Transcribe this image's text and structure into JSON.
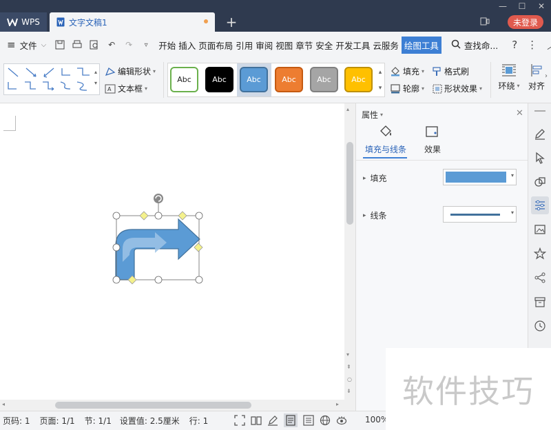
{
  "app": {
    "name": "WPS",
    "doc_tab": "文字文稿1",
    "login": "未登录"
  },
  "menu": {
    "file": "文件",
    "tabs": [
      "开始",
      "插入",
      "页面布局",
      "引用",
      "审阅",
      "视图",
      "章节",
      "安全",
      "开发工具",
      "云服务",
      "绘图工具"
    ],
    "active_tab": "绘图工具",
    "search": "查找命..."
  },
  "ribbon": {
    "edit_shape": "编辑形状",
    "text_box": "文本框",
    "styles": [
      {
        "label": "Abc",
        "fill": "#ffffff",
        "border": "#6ab04c",
        "text": "#222222"
      },
      {
        "label": "Abc",
        "fill": "#000000",
        "border": "#000000",
        "text": "#ffffff"
      },
      {
        "label": "Abc",
        "fill": "#5b9bd5",
        "border": "#41719c",
        "text": "#ffffff",
        "selected": true
      },
      {
        "label": "Abc",
        "fill": "#ed7d31",
        "border": "#c55a11",
        "text": "#ffffff"
      },
      {
        "label": "Abc",
        "fill": "#a5a5a5",
        "border": "#7f7f7f",
        "text": "#ffffff"
      },
      {
        "label": "Abc",
        "fill": "#ffc000",
        "border": "#bf9000",
        "text": "#ffffff"
      }
    ],
    "fill": "填充",
    "format_painter": "格式刷",
    "outline": "轮廓",
    "shape_effects": "形状效果",
    "wrap": "环绕",
    "align": "对齐"
  },
  "panel": {
    "title": "属性",
    "tab_fill_line": "填充与线条",
    "tab_effects": "效果",
    "fill_label": "填充",
    "fill_color": "#5b9bd5",
    "line_label": "线条",
    "line_color": "#41719c"
  },
  "status": {
    "page_no": "页码: 1",
    "pages": "页面: 1/1",
    "section": "节: 1/1",
    "setting": "设置值: 2.5厘米",
    "row": "行: 1",
    "zoom": "100%"
  },
  "watermark": "软件技巧"
}
